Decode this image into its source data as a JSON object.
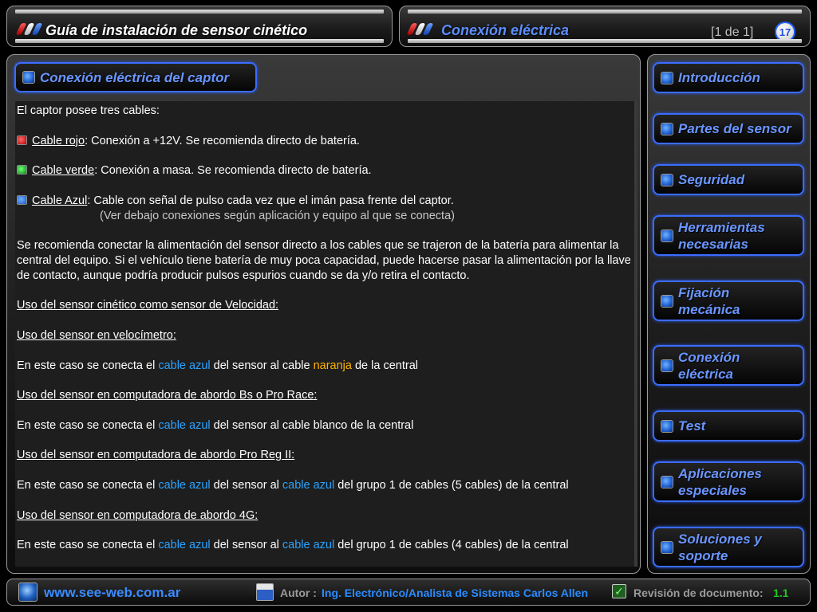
{
  "header_left": {
    "title": "Guía de instalación de sensor cinético"
  },
  "header_right": {
    "title": "Conexión eléctrica",
    "page_count": "[1 de 1]",
    "slide_number": "17"
  },
  "section": {
    "title": "Conexión eléctrica del captor"
  },
  "content": {
    "intro": "El captor posee tres cables:",
    "cables": [
      {
        "name": "Cable rojo",
        "desc": ": Conexión a +12V. Se recomienda directo de batería."
      },
      {
        "name": "Cable verde",
        "desc": ": Conexión a masa. Se recomienda directo de batería."
      },
      {
        "name": "Cable Azul",
        "desc": ": Cable con señal de pulso cada vez que el imán pasa frente del captor."
      }
    ],
    "note": "(Ver debajo conexiones según aplicación y equipo al que se conecta)",
    "paragraph": "Se recomienda conectar la alimentación del sensor directo a los cables que se trajeron de la batería para alimentar la central del equipo. Si el vehículo tiene batería de muy poca capacidad, puede hacerse pasar la alimentación por la llave de contacto, aunque podría producir pulsos espurios cuando se da y/o retira el contacto.",
    "heading_speed": "Uso del sensor cinético como sensor de Velocidad:",
    "heading_velo": "Uso del sensor en velocímetro:",
    "line_velo": {
      "pre": "En este caso se conecta el ",
      "blue": "cable azul",
      "mid": " del sensor al cable ",
      "orange": "naranja",
      "post": " de la central"
    },
    "heading_bs": "Uso del sensor en computadora de abordo Bs o Pro Race:",
    "line_bs": {
      "pre": "En este caso se conecta el ",
      "blue": "cable azul",
      "post": " del sensor al cable blanco de la central"
    },
    "heading_proreg": "Uso del sensor en computadora de abordo Pro Reg II:",
    "line_proreg": {
      "pre": "En este caso se conecta el ",
      "blue1": "cable azul",
      "mid": " del sensor al ",
      "blue2": "cable azul",
      "post": " del grupo 1 de cables (5 cables) de la central"
    },
    "heading_4g": "Uso del sensor en computadora de abordo 4G:",
    "line_4g": {
      "pre": "En este caso se conecta el ",
      "blue1": "cable azul",
      "mid": " del sensor al ",
      "blue2": "cable azul",
      "post": " del grupo 1 de cables (4 cables) de la central"
    }
  },
  "nav": [
    {
      "label": "Introducción"
    },
    {
      "label": "Partes del sensor"
    },
    {
      "label": "Seguridad"
    },
    {
      "label": "Herramientas necesarias"
    },
    {
      "label": "Fijación mecánica"
    },
    {
      "label": "Conexión eléctrica"
    },
    {
      "label": "Test"
    },
    {
      "label": "Aplicaciones especiales"
    },
    {
      "label": "Soluciones y soporte"
    }
  ],
  "footer": {
    "site": "www.see-web.com.ar",
    "author_label": "Autor :",
    "author": "Ing. Electrónico/Analista de Sistemas Carlos Allen",
    "revision_label": "Revisión de documento:",
    "revision": "1.1"
  }
}
